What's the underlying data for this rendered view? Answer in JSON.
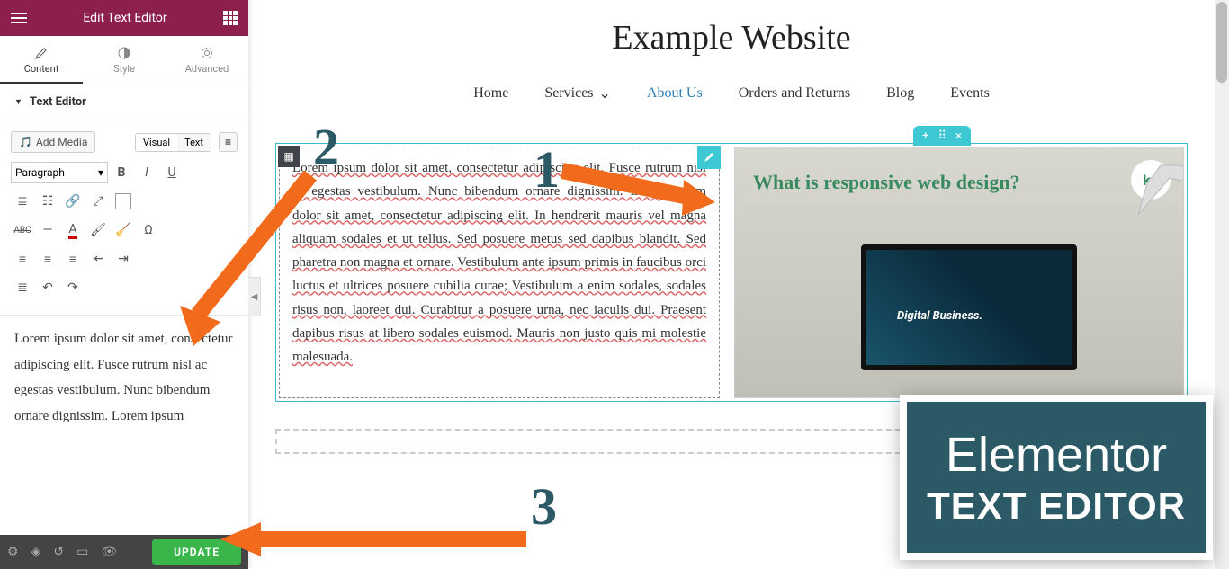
{
  "panel": {
    "title": "Edit Text Editor",
    "tabs": {
      "content": "Content",
      "style": "Style",
      "advanced": "Advanced"
    },
    "section": "Text Editor",
    "add_media": "Add Media",
    "mode_visual": "Visual",
    "mode_text": "Text",
    "para_select": "Paragraph",
    "editor_text": "Lorem ipsum dolor sit amet, consectetur adipiscing elit. Fusce rutrum nisl ac egestas vestibulum. Nunc bibendum ornare dignissim. Lorem ipsum",
    "update": "UPDATE"
  },
  "preview": {
    "site_title": "Example Website",
    "nav": {
      "home": "Home",
      "services": "Services",
      "about": "About Us",
      "orders": "Orders and Returns",
      "blog": "Blog",
      "events": "Events"
    },
    "text_block": "Lorem ipsum dolor sit amet, consectetur adipiscing elit. Fusce rutrum nisl ac egestas vestibulum. Nunc bibendum ornare dignissim. Lorem ipsum dolor sit amet, consectetur adipiscing elit. In hendrerit mauris vel magna aliquam sodales et ut tellus. Sed posuere metus sed dapibus blandit. Sed pharetra non magna et ornare. Vestibulum ante ipsum primis in faucibus orci luctus et ultrices posuere cubilia curae; Vestibulum a enim sodales, sodales risus non, laoreet dui. Curabitur a posuere urna, nec iaculis dui. Praesent dapibus risus at libero sodales euismod. Mauris non justo quis mi molestie malesuada.",
    "banner": "What is responsive web design?",
    "banner_sub": "Digital Business.",
    "kd": "kd"
  },
  "annotations": {
    "n1": "1",
    "n2": "2",
    "n3": "3",
    "badge_l1": "Elementor",
    "badge_l2": "TEXT EDITOR"
  }
}
